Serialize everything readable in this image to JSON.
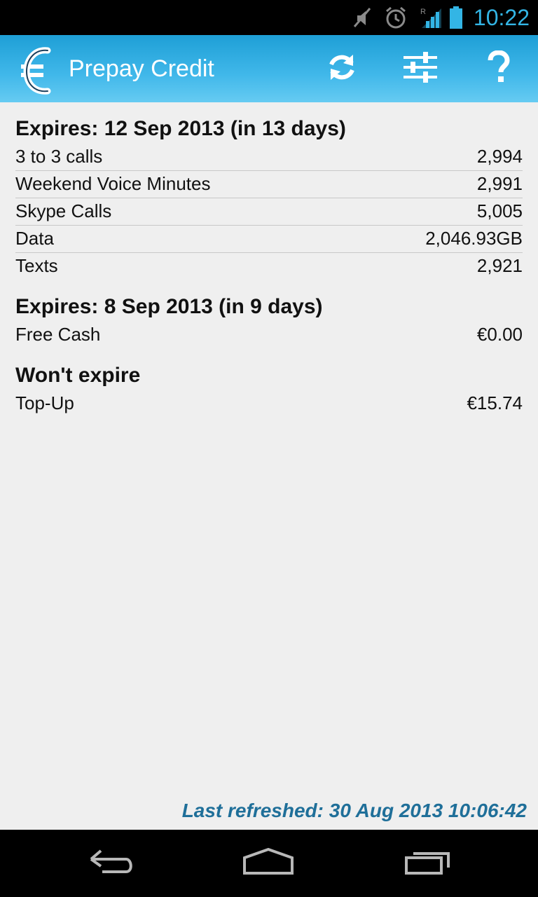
{
  "status_bar": {
    "time": "10:22",
    "icons": [
      "mute-icon",
      "alarm-icon",
      "signal-roaming-icon",
      "battery-icon"
    ]
  },
  "action_bar": {
    "title": "Prepay Credit",
    "logo_icon": "euro-phone-icon",
    "actions": [
      {
        "name": "refresh-button",
        "icon": "refresh-icon"
      },
      {
        "name": "settings-button",
        "icon": "sliders-icon"
      },
      {
        "name": "help-button",
        "icon": "help-icon"
      }
    ]
  },
  "sections": [
    {
      "heading": "Expires: 12 Sep 2013 (in 13 days)",
      "rows": [
        {
          "label": "3 to 3 calls",
          "value": "2,994"
        },
        {
          "label": "Weekend Voice Minutes",
          "value": "2,991"
        },
        {
          "label": "Skype Calls",
          "value": "5,005"
        },
        {
          "label": "Data",
          "value": "2,046.93GB"
        },
        {
          "label": "Texts",
          "value": "2,921"
        }
      ]
    },
    {
      "heading": "Expires: 8 Sep 2013 (in 9 days)",
      "rows": [
        {
          "label": "Free Cash",
          "value": "€0.00"
        }
      ]
    },
    {
      "heading": "Won't expire",
      "rows": [
        {
          "label": "Top-Up",
          "value": "€15.74"
        }
      ]
    }
  ],
  "footer": {
    "last_refreshed": "Last refreshed: 30 Aug 2013 10:06:42"
  },
  "nav_bar": {
    "buttons": [
      "back-icon",
      "home-icon",
      "recents-icon"
    ]
  },
  "colors": {
    "accent": "#33b5e5",
    "action_bar_top": "#1e9fd6",
    "refreshed_text": "#1f6f99"
  }
}
